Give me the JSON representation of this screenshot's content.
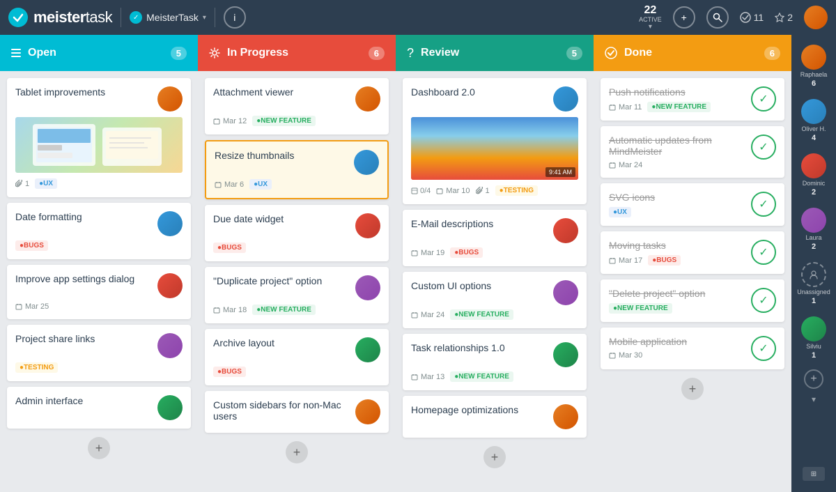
{
  "app": {
    "name_prefix": "meister",
    "name_suffix": "task",
    "project_name": "MeisterTask",
    "active_count": "22",
    "active_label": "ACTIVE",
    "tasks_count": "11",
    "stars_count": "2",
    "info_label": "i"
  },
  "columns": [
    {
      "id": "open",
      "title": "Open",
      "count": "5",
      "icon": "hamburger",
      "cards": [
        {
          "id": "c1",
          "title": "Tablet improvements",
          "avatar_class": "av-raphaela",
          "has_image": true,
          "attachment_count": "1",
          "tag": "UX",
          "tag_class": "tag-ux"
        },
        {
          "id": "c2",
          "title": "Date formatting",
          "tag": "BUGS",
          "tag_class": "tag-bugs",
          "avatar_class": "av-oliver"
        },
        {
          "id": "c3",
          "title": "Improve app settings dialog",
          "date": "Mar 25",
          "avatar_class": "av-dominic"
        },
        {
          "id": "c4",
          "title": "Project share links",
          "tag": "TESTING",
          "tag_class": "tag-testing",
          "avatar_class": "av-laura"
        },
        {
          "id": "c5",
          "title": "Admin interface",
          "avatar_class": "av-silviu"
        }
      ]
    },
    {
      "id": "inprogress",
      "title": "In Progress",
      "count": "6",
      "icon": "gear",
      "cards": [
        {
          "id": "c6",
          "title": "Attachment viewer",
          "date": "Mar 12",
          "tag": "NEW FEATURE",
          "tag_class": "tag-new-feature",
          "avatar_class": "av-raphaela"
        },
        {
          "id": "c7",
          "title": "Resize thumbnails",
          "date": "Mar 6",
          "tag": "UX",
          "tag_class": "tag-ux",
          "avatar_class": "av-oliver",
          "highlighted": true
        },
        {
          "id": "c8",
          "title": "Due date widget",
          "tag": "BUGS",
          "tag_class": "tag-bugs",
          "avatar_class": "av-dominic"
        },
        {
          "id": "c9",
          "title": "\"Duplicate project\" option",
          "date": "Mar 18",
          "tag": "NEW FEATURE",
          "tag_class": "tag-new-feature",
          "avatar_class": "av-laura"
        },
        {
          "id": "c10",
          "title": "Archive layout",
          "tag": "BUGS",
          "tag_class": "tag-bugs",
          "avatar_class": "av-silviu"
        },
        {
          "id": "c11",
          "title": "Custom sidebars for non-Mac users",
          "avatar_class": "av-raphaela"
        }
      ]
    },
    {
      "id": "review",
      "title": "Review",
      "count": "5",
      "icon": "question",
      "cards": [
        {
          "id": "c12",
          "title": "Dashboard 2.0",
          "has_image": true,
          "progress": "0/4",
          "date": "Mar 10",
          "attachment_count": "1",
          "tag": "TESTING",
          "tag_class": "tag-testing",
          "avatar_class": "av-oliver"
        },
        {
          "id": "c13",
          "title": "E-Mail descriptions",
          "date": "Mar 19",
          "tag": "BUGS",
          "tag_class": "tag-bugs",
          "avatar_class": "av-dominic"
        },
        {
          "id": "c14",
          "title": "Custom UI options",
          "date": "Mar 24",
          "tag": "NEW FEATURE",
          "tag_class": "tag-new-feature",
          "avatar_class": "av-laura"
        },
        {
          "id": "c15",
          "title": "Task relationships 1.0",
          "date": "Mar 13",
          "tag": "NEW FEATURE",
          "tag_class": "tag-new-feature",
          "avatar_class": "av-silviu"
        },
        {
          "id": "c16",
          "title": "Homepage optimizations",
          "avatar_class": "av-raphaela"
        }
      ]
    },
    {
      "id": "done",
      "title": "Done",
      "count": "6",
      "icon": "check",
      "cards": [
        {
          "id": "c17",
          "title": "Push notifications",
          "date": "Mar 11",
          "tag": "NEW FEATURE",
          "tag_class": "tag-new-feature",
          "strikethrough": true
        },
        {
          "id": "c18",
          "title": "Automatic updates from MindMeister",
          "date": "Mar 24",
          "strikethrough": true
        },
        {
          "id": "c19",
          "title": "SVG icons",
          "tag": "UX",
          "tag_class": "tag-ux",
          "strikethrough": true
        },
        {
          "id": "c20",
          "title": "Moving tasks",
          "date": "Mar 17",
          "tag": "BUGS",
          "tag_class": "tag-bugs",
          "strikethrough": true
        },
        {
          "id": "c21",
          "title": "\"Delete project\" option",
          "tag": "NEW FEATURE",
          "tag_class": "tag-new-feature",
          "strikethrough": true
        },
        {
          "id": "c22",
          "title": "Mobile application",
          "date": "Mar 30",
          "strikethrough": true
        }
      ]
    }
  ],
  "sidebar_users": [
    {
      "name": "Raphaela",
      "count": "6",
      "avatar_class": "av-raphaela"
    },
    {
      "name": "Oliver H.",
      "count": "4",
      "avatar_class": "av-oliver"
    },
    {
      "name": "Dominic",
      "count": "2",
      "avatar_class": "av-dominic"
    },
    {
      "name": "Laura",
      "count": "2",
      "avatar_class": "av-laura"
    },
    {
      "name": "Unassigned",
      "count": "1",
      "avatar_class": "unassigned"
    },
    {
      "name": "Silviu",
      "count": "1",
      "avatar_class": "av-silviu"
    }
  ]
}
